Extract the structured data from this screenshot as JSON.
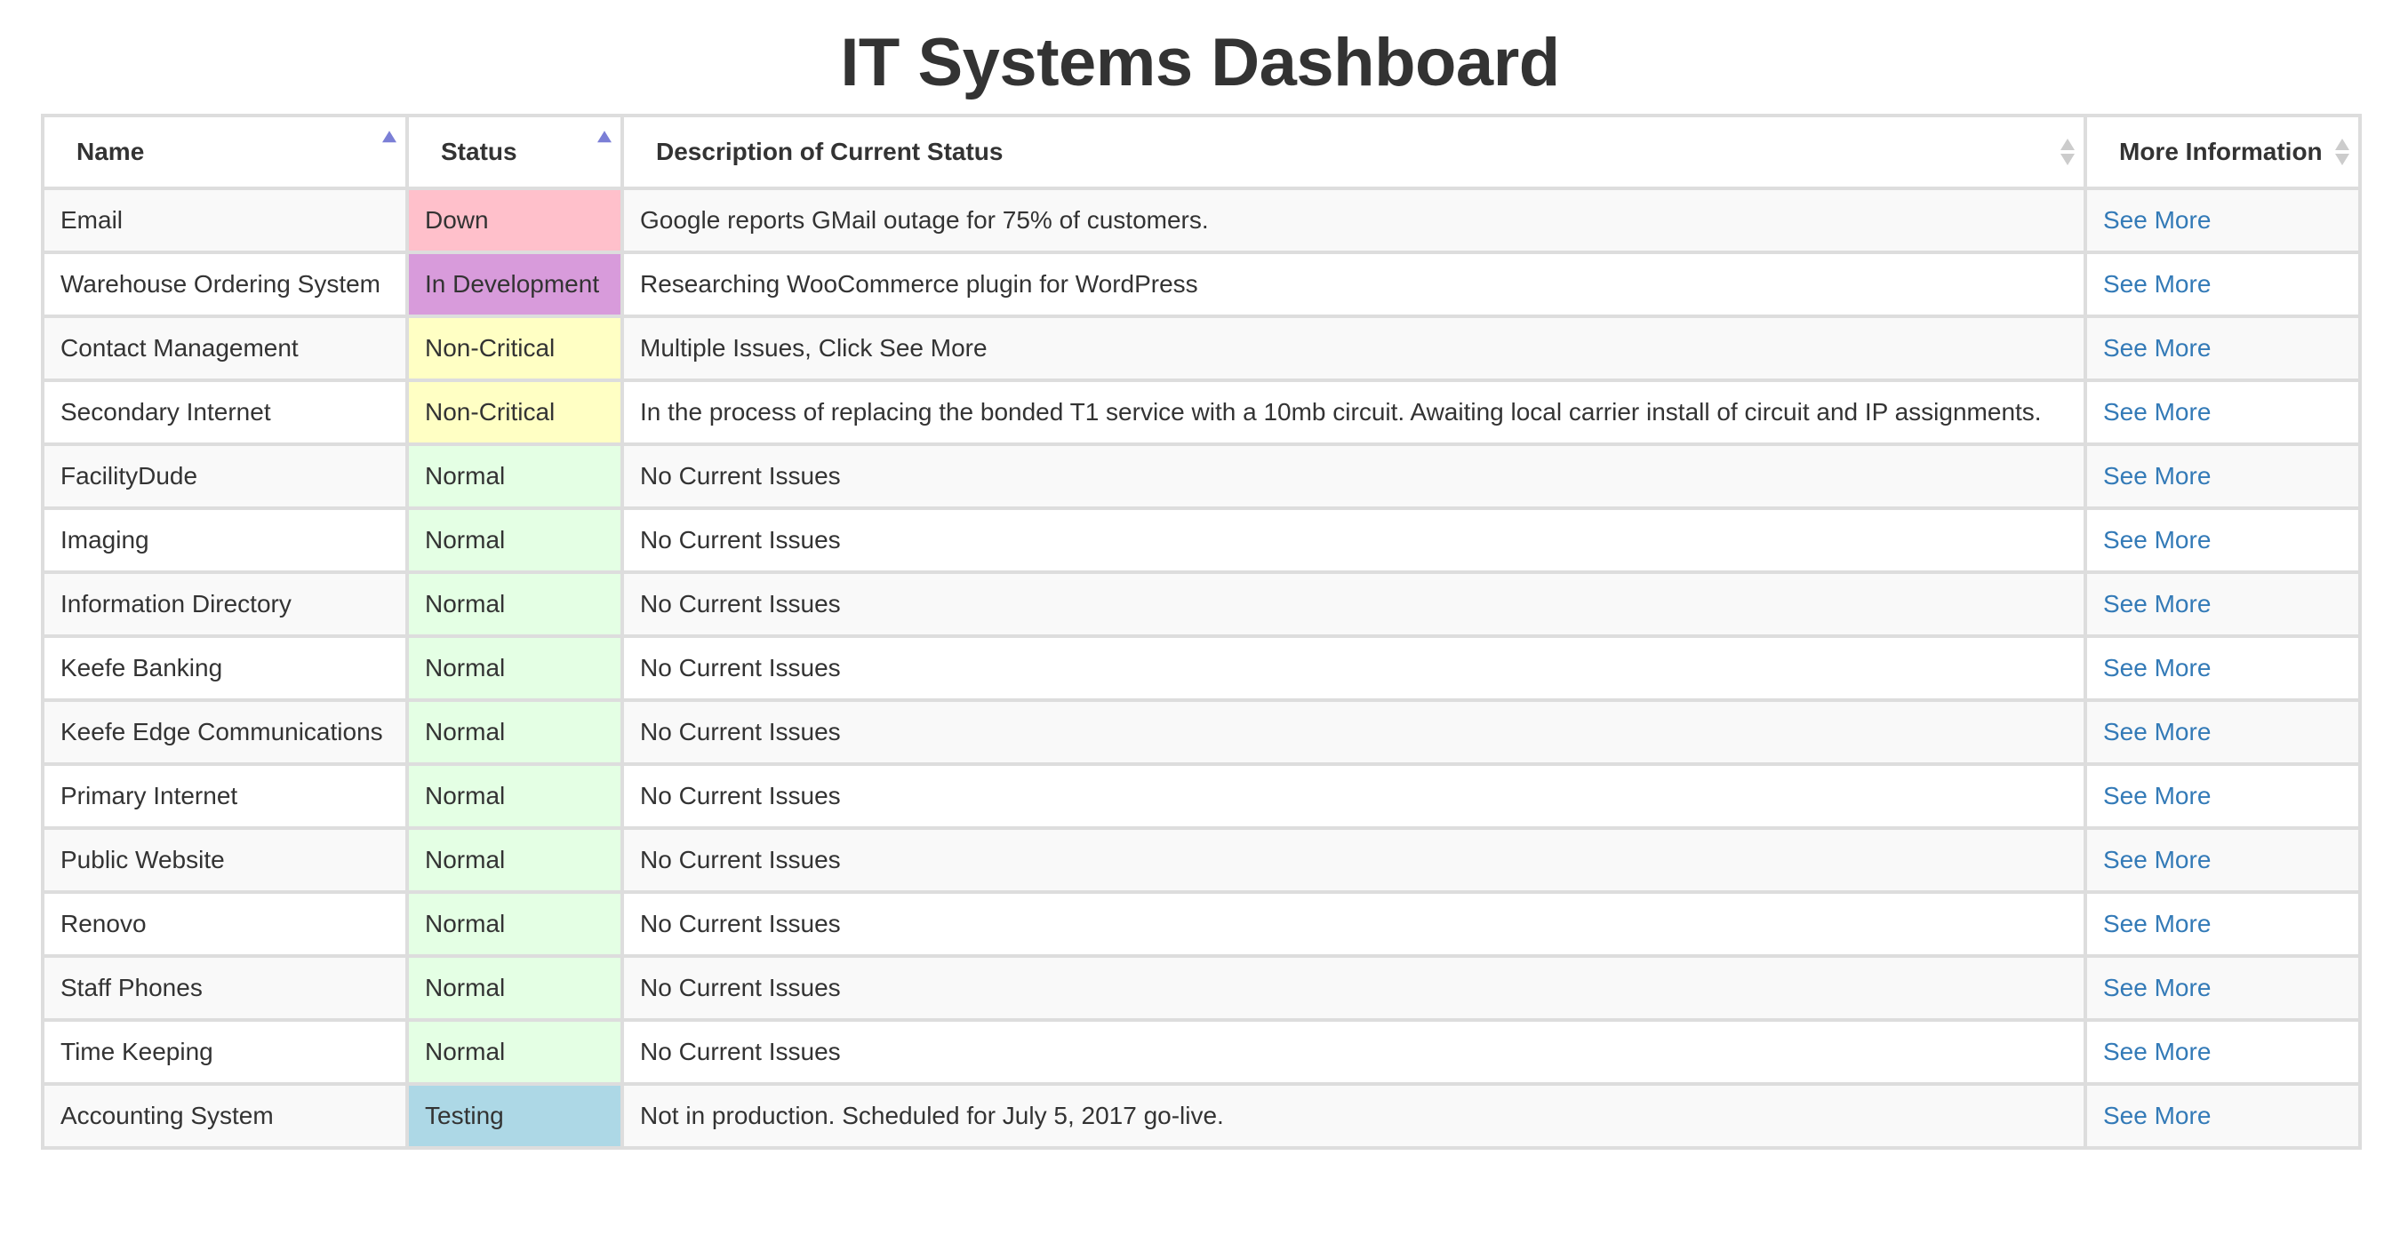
{
  "page": {
    "title": "IT Systems Dashboard"
  },
  "table": {
    "columns": [
      {
        "label": "Name",
        "sort": "asc"
      },
      {
        "label": "Status",
        "sort": "asc"
      },
      {
        "label": "Description of Current Status",
        "sort": "none"
      },
      {
        "label": "More Information",
        "sort": "none"
      }
    ],
    "status_colors": {
      "Down": "#ffc0cb",
      "In Development": "#d89bdb",
      "Non-Critical": "#ffffc4",
      "Normal": "#e4ffe4",
      "Testing": "#add8e6"
    },
    "link_color": "#337ab7",
    "rows": [
      {
        "name": "Email",
        "status": "Down",
        "description": "Google reports GMail outage for 75% of customers.",
        "link": "See More"
      },
      {
        "name": "Warehouse Ordering System",
        "status": "In Development",
        "description": "Researching WooCommerce plugin for WordPress",
        "link": "See More"
      },
      {
        "name": "Contact Management",
        "status": "Non-Critical",
        "description": "Multiple Issues, Click See More",
        "link": "See More"
      },
      {
        "name": "Secondary Internet",
        "status": "Non-Critical",
        "description": "In the process of replacing the bonded T1 service with a 10mb circuit. Awaiting local carrier install of circuit and IP assignments.",
        "link": "See More"
      },
      {
        "name": "FacilityDude",
        "status": "Normal",
        "description": "No Current Issues",
        "link": "See More"
      },
      {
        "name": "Imaging",
        "status": "Normal",
        "description": "No Current Issues",
        "link": "See More"
      },
      {
        "name": "Information Directory",
        "status": "Normal",
        "description": "No Current Issues",
        "link": "See More"
      },
      {
        "name": "Keefe Banking",
        "status": "Normal",
        "description": "No Current Issues",
        "link": "See More"
      },
      {
        "name": "Keefe Edge Communications",
        "status": "Normal",
        "description": "No Current Issues",
        "link": "See More"
      },
      {
        "name": "Primary Internet",
        "status": "Normal",
        "description": "No Current Issues",
        "link": "See More"
      },
      {
        "name": "Public Website",
        "status": "Normal",
        "description": "No Current Issues",
        "link": "See More"
      },
      {
        "name": "Renovo",
        "status": "Normal",
        "description": "No Current Issues",
        "link": "See More"
      },
      {
        "name": "Staff Phones",
        "status": "Normal",
        "description": "No Current Issues",
        "link": "See More"
      },
      {
        "name": "Time Keeping",
        "status": "Normal",
        "description": "No Current Issues",
        "link": "See More"
      },
      {
        "name": "Accounting System",
        "status": "Testing",
        "description": "Not in production. Scheduled for July 5, 2017 go-live.",
        "link": "See More"
      }
    ]
  }
}
